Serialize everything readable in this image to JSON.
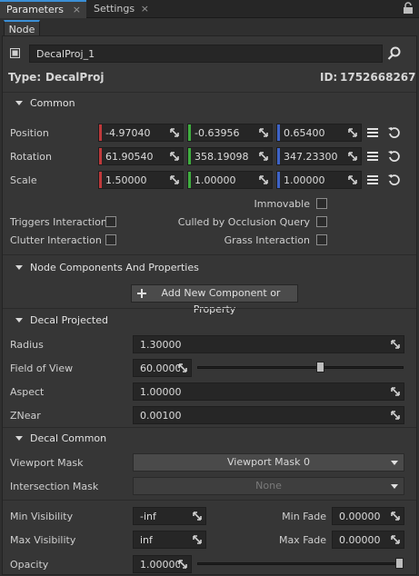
{
  "tabs": [
    {
      "label": "Parameters"
    },
    {
      "label": "Settings"
    }
  ],
  "subtab": "Node",
  "node": {
    "name": "DecalProj_1"
  },
  "header": {
    "type_label": "Type:",
    "type_value": "DecalProj",
    "id_label": "ID:",
    "id_value": "1752668267"
  },
  "common": {
    "title": "Common",
    "position": {
      "label": "Position",
      "x": "-4.97040",
      "y": "-0.63956",
      "z": "0.65400"
    },
    "rotation": {
      "label": "Rotation",
      "x": "61.90540",
      "y": "358.19098",
      "z": "347.23300"
    },
    "scale": {
      "label": "Scale",
      "x": "1.50000",
      "y": "1.00000",
      "z": "1.00000"
    },
    "flags": {
      "immovable": "Immovable",
      "triggers": "Triggers Interaction",
      "culled": "Culled by Occlusion Query",
      "clutter": "Clutter Interaction",
      "grass": "Grass Interaction"
    }
  },
  "components": {
    "title": "Node Components And Properties",
    "add_button": "Add New Component or Property"
  },
  "decal_projected": {
    "title": "Decal Projected",
    "radius": {
      "label": "Radius",
      "value": "1.30000"
    },
    "fov": {
      "label": "Field of View",
      "value": "60.00000",
      "slider": 0.6
    },
    "aspect": {
      "label": "Aspect",
      "value": "1.00000"
    },
    "znear": {
      "label": "ZNear",
      "value": "0.00100"
    }
  },
  "decal_common": {
    "title": "Decal Common",
    "viewport_mask": {
      "label": "Viewport Mask",
      "value": "Viewport Mask 0"
    },
    "intersection_mask": {
      "label": "Intersection Mask",
      "value": "None"
    },
    "min_visibility": {
      "label": "Min Visibility",
      "value": "-inf"
    },
    "min_fade": {
      "label": "Min Fade",
      "value": "0.00000"
    },
    "max_visibility": {
      "label": "Max Visibility",
      "value": "inf"
    },
    "max_fade": {
      "label": "Max Fade",
      "value": "0.00000"
    },
    "opacity": {
      "label": "Opacity",
      "value": "1.00000",
      "slider": 1.0
    }
  },
  "colors": {
    "accent": "#3b8fd6",
    "x_axis": "#c0393b",
    "y_axis": "#3fae3f",
    "z_axis": "#3d63c7"
  },
  "icons": [
    "close-icon",
    "lock-icon",
    "node-icon",
    "search-icon",
    "expand-handle-icon",
    "menu-icon",
    "reset-icon",
    "plus-icon",
    "chevron-down-icon"
  ]
}
